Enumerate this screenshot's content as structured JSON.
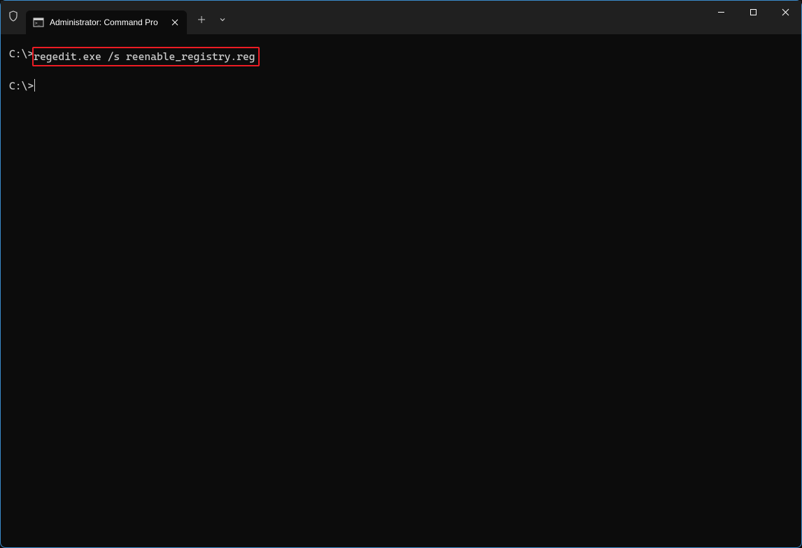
{
  "titlebar": {
    "tab_title": "Administrator: Command Pro"
  },
  "terminal": {
    "lines": [
      {
        "prompt": "C:\\>",
        "command": "regedit.exe /s reenable_registry.reg",
        "highlighted": true
      },
      {
        "prompt": "C:\\>",
        "command": "",
        "cursor": true
      }
    ]
  }
}
